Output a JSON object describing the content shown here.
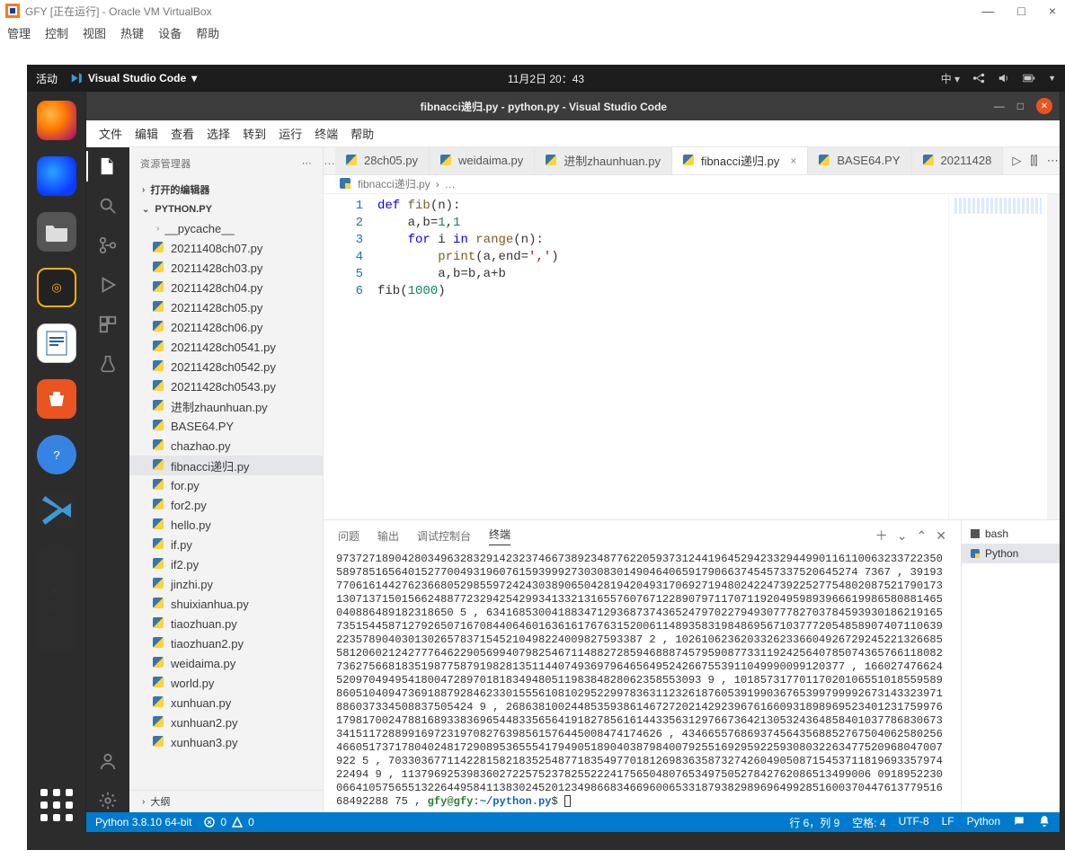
{
  "host": {
    "window_title": "GFY [正在运行] - Oracle VM VirtualBox",
    "menu": [
      "管理",
      "控制",
      "视图",
      "热键",
      "设备",
      "帮助"
    ],
    "controls": {
      "minimize": "—",
      "maximize": "□",
      "close": "×"
    }
  },
  "ubuntu": {
    "activities": "活动",
    "app_name": "Visual Studio Code",
    "datetime": "11月2日  20：43",
    "lang": "中 ▾",
    "dock": {
      "firefox": "firefox",
      "thunderbird": "thunderbird",
      "files": "files",
      "music": "rhythmbox",
      "writer": "libreoffice-writer",
      "store": "ubuntu-software",
      "help": "?",
      "vscode": "visual-studio-code",
      "terminal": ">_"
    }
  },
  "vscode": {
    "title": "fibnacci递归.py - python.py - Visual Studio Code",
    "window_controls": {
      "minimize": "—",
      "maximize": "□",
      "close": "×"
    },
    "menu": [
      "文件",
      "编辑",
      "查看",
      "选择",
      "转到",
      "运行",
      "终端",
      "帮助"
    ]
  },
  "sidebar": {
    "header": "资源管理器",
    "open_editors": "打开的编辑器",
    "project": "PYTHON.PY",
    "folder": "__pycache__",
    "files": [
      "20211408ch07.py",
      "20211428ch03.py",
      "20211428ch04.py",
      "20211428ch05.py",
      "20211428ch06.py",
      "20211428ch0541.py",
      "20211428ch0542.py",
      "20211428ch0543.py",
      "进制zhaunhuan.py",
      "BASE64.PY",
      "chazhao.py",
      "fibnacci递归.py",
      "for.py",
      "for2.py",
      "hello.py",
      "if.py",
      "if2.py",
      "jinzhi.py",
      "shuixianhua.py",
      "tiaozhuan.py",
      "tiaozhuan2.py",
      "weidaima.py",
      "world.py",
      "xunhuan.py",
      "xunhuan2.py",
      "xunhuan3.py"
    ],
    "active_file": "fibnacci递归.py",
    "outline": "大纲"
  },
  "tabs": {
    "more_left": "…",
    "items": [
      "28ch05.py",
      "weidaima.py",
      "进制zhaunhuan.py",
      "fibnacci递归.py",
      "BASE64.PY",
      "20211428"
    ],
    "active": "fibnacci递归.py",
    "actions": {
      "run": "▷",
      "split": "⫿⫿",
      "more": "⋯"
    }
  },
  "breadcrumb": {
    "file": "fibnacci递归.py",
    "sep": "›",
    "more": "…"
  },
  "editor": {
    "line_numbers": [
      "1",
      "2",
      "3",
      "4",
      "5",
      "6"
    ],
    "code": {
      "l1_def": "def",
      "l1_fn": "fib",
      "l1_rest": "(n):",
      "l2": "a,b",
      "l2_eq": "=",
      "l2_n1": "1",
      "l2_c": ",",
      "l2_n2": "1",
      "l3_for": "for",
      "l3_i": "i",
      "l3_in": "in",
      "l3_range": "range",
      "l3_rest": "(n):",
      "l4_print": "print",
      "l4_open": "(a,end=",
      "l4_str": "','",
      "l4_close": ")",
      "l5": "a,b",
      "l5_eq": "=",
      "l5_rhs": "b,a+b",
      "l6_call": "fib(",
      "l6_num": "1000",
      "l6_close": ")"
    }
  },
  "panel": {
    "tabs": {
      "problems": "问题",
      "output": "输出",
      "debug": "调试控制台",
      "terminal": "终端"
    },
    "actions": {
      "new": "＋",
      "dropdown": "⌄",
      "up": "⌃",
      "close": "✕"
    },
    "shells": {
      "bash": "bash",
      "python": "Python"
    },
    "terminal_text": "97372718904280349632832914232374667389234877622059373124419645294233294499011611006323372235058978516564015277004931960761593999273030830149046406591790663745457337520645274 7367 , 39193770616144276236680529855972424303890650428194204931706927194802422473922527754802087521790173130713715015662488772329425429934133213165576076712289079711707119204959893966619986580881465040886489182318650 5 , 634168530041883471293687374365247970227949307778270378459393018621916573515445871279265071670844064601636161767631520061148935831984869567103777205485890740711063922357890403013026578371545210498224009827593387 2 , 10261062362033262336604926729245221326685581206021242777646229056994079825467114882728594688874579590877331192425640785074365766118082736275668183519877587919828135114407493697964656495242667553911049990099120377 , 16602747662452097049495418004728970181834948051198384828062358553093 9 , 10185731770117020106551018559589860510409473691887928462330155561081029522997836311232618760539199036765399799992673143323971886037334508837505424 9 , 268638100244853593861467272021429239676166093189896952340123175997617981700247881689338369654483356564191827856161443356312976673642130532436485840103778683067334151172889916972319708276398561576445008474174626 , 4346655768693745643568852767504062580256466051737178040248172908953655541794905189040387984007925516929592259308032263477520968047007922 5 , 703303677114228158218352548771835497701812698363587327426049050871545371181969335797422494 9 , 113796925398360272257523782552224175650480765349750527842762086513499006 091895223006641057565513226449584113830245201234986683466960065331879382989696499285160037044761377951668492288 75 , ",
    "prompt_user": "gfy@gfy",
    "prompt_sep": ":",
    "prompt_path": "~/python.py",
    "prompt_dollar": "$ "
  },
  "status": {
    "python": "Python 3.8.10 64-bit",
    "errors": "0",
    "warnings": "0",
    "line_col": "行 6，列 9",
    "spaces": "空格: 4",
    "encoding": "UTF-8",
    "eol": "LF",
    "lang": "Python"
  }
}
